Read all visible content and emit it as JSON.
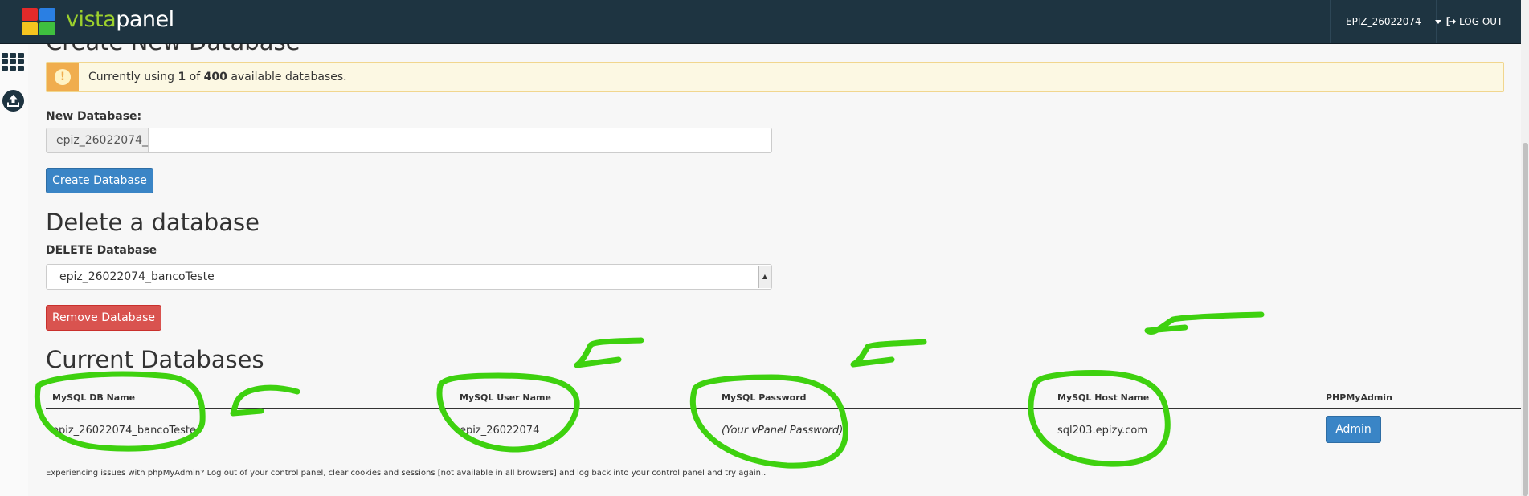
{
  "header": {
    "logo_prefix": "vista",
    "logo_suffix": "panel",
    "username": "EPIZ_26022074",
    "logout_label": "LOG OUT"
  },
  "sidebar": {
    "icons": [
      "apps-grid-icon",
      "upload-icon"
    ]
  },
  "create_section": {
    "title": "Create New Database",
    "alert": {
      "prefix": "Currently using ",
      "used": "1",
      "middle": " of ",
      "total": "400",
      "suffix": " available databases."
    },
    "new_db_label": "New Database:",
    "db_prefix": "epiz_26022074_",
    "new_db_value": "",
    "create_button": "Create Database"
  },
  "delete_section": {
    "title": "Delete a database",
    "select_label": "DELETE Database",
    "selected_db": "epiz_26022074_bancoTeste",
    "remove_button": "Remove Database"
  },
  "current_section": {
    "title": "Current Databases",
    "columns": [
      "MySQL DB Name",
      "MySQL User Name",
      "MySQL Password",
      "MySQL Host Name",
      "PHPMyAdmin"
    ],
    "rows": [
      {
        "db_name": "epiz_26022074_bancoTeste",
        "user_name": "epiz_26022074",
        "password": "(Your vPanel Password)",
        "host_name": "sql203.epizy.com",
        "admin_button": "Admin"
      }
    ],
    "footer_note": "Experiencing issues with phpMyAdmin? Log out of your control panel, clear cookies and sessions [not available in all browsers] and log back into your control panel and try again.."
  },
  "colors": {
    "topbar": "#1e3441",
    "accent_blue": "#3a85c6",
    "danger_red": "#d9534f",
    "warning_yellow": "#f0ad4e",
    "annotation_green": "#3ed10f"
  }
}
